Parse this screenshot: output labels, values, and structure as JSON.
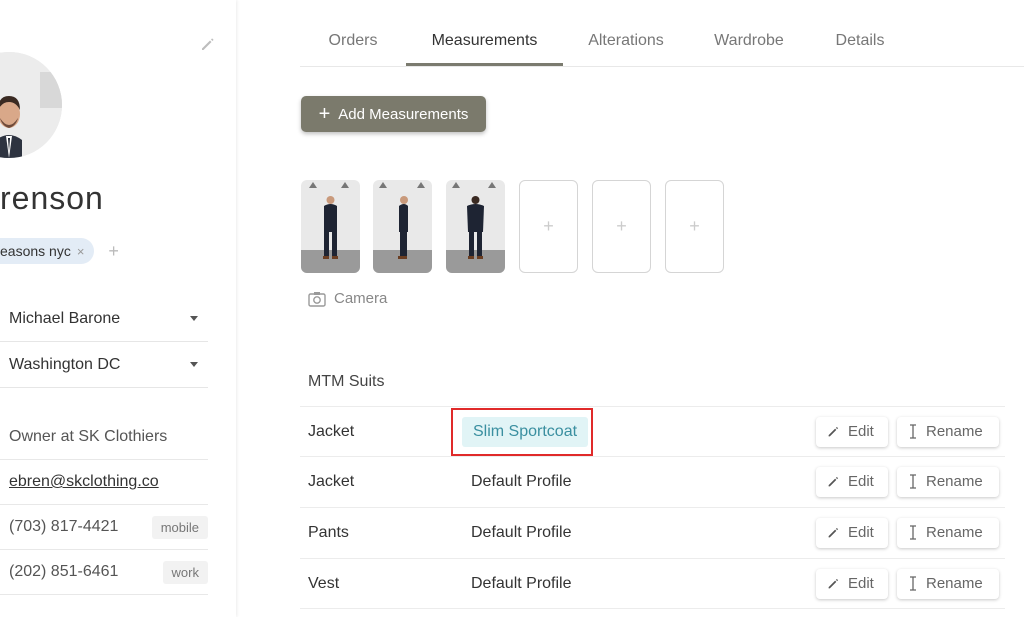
{
  "profile": {
    "name": "renson",
    "tag": "easons nyc",
    "tag_remove": "×",
    "tag_add": "+",
    "stylist": "Michael Barone",
    "location": "Washington DC",
    "title": "Owner at SK Clothiers",
    "email": "ebren@skclothing.co",
    "phones": [
      {
        "number": "(703) 817-4421",
        "label": "mobile"
      },
      {
        "number": "(202) 851-6461",
        "label": "work"
      }
    ]
  },
  "tabs": [
    "Orders",
    "Measurements",
    "Alterations",
    "Wardrobe",
    "Details"
  ],
  "active_tab": "Measurements",
  "add_button": {
    "icon": "+",
    "label": "Add Measurements"
  },
  "photos": {
    "empty_slot": "+",
    "camera_label": "Camera"
  },
  "section": {
    "title": "MTM Suits"
  },
  "rows": [
    {
      "garment": "Jacket",
      "profile": "Slim Sportcoat"
    },
    {
      "garment": "Jacket",
      "profile": "Default Profile"
    },
    {
      "garment": "Pants",
      "profile": "Default Profile"
    },
    {
      "garment": "Vest",
      "profile": "Default Profile"
    }
  ],
  "actions": {
    "edit": "Edit",
    "rename": "Rename"
  },
  "colors": {
    "accent": "#7b7a6c",
    "highlight": "#e02a2a",
    "chip_bg": "#e1f4f6",
    "chip_text": "#3a8fa0",
    "tag_bg": "#e3ecf6"
  }
}
